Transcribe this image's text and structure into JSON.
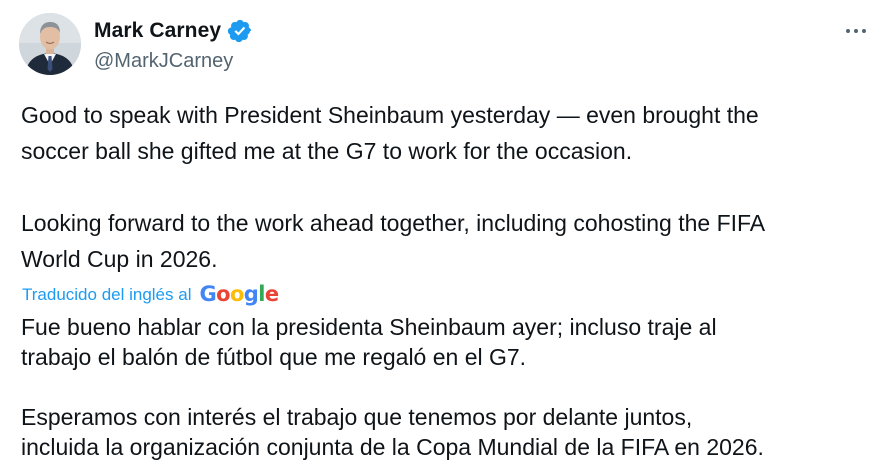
{
  "author": {
    "display_name": "Mark Carney",
    "handle": "@MarkJCarney",
    "verified_color": "#1d9bf0"
  },
  "menu": {
    "icon": "more-horizontal-icon"
  },
  "tweet": {
    "text": "Good to speak with President Sheinbaum yesterday — even brought the\nsoccer ball she gifted me at the G7 to work for the occasion.\n\nLooking forward to the work ahead together, including cohosting the FIFA\nWorld Cup in 2026.",
    "translation_label": "Traducido del inglés al",
    "translation_provider": "Google",
    "translated_text": "Fue bueno hablar con la presidenta Sheinbaum ayer; incluso traje al\ntrabajo el balón de fútbol que me regaló en el G7.\n\nEsperamos con interés el trabajo que tenemos por delante juntos,\nincluida la organización conjunta de la Copa Mundial de la FIFA en 2026."
  },
  "colors": {
    "text": "#0f1419",
    "secondary": "#536471",
    "link": "#1d9bf0",
    "google_blue": "#4285f4",
    "google_red": "#ea4335",
    "google_yellow": "#fbbc05",
    "google_green": "#34a853"
  }
}
